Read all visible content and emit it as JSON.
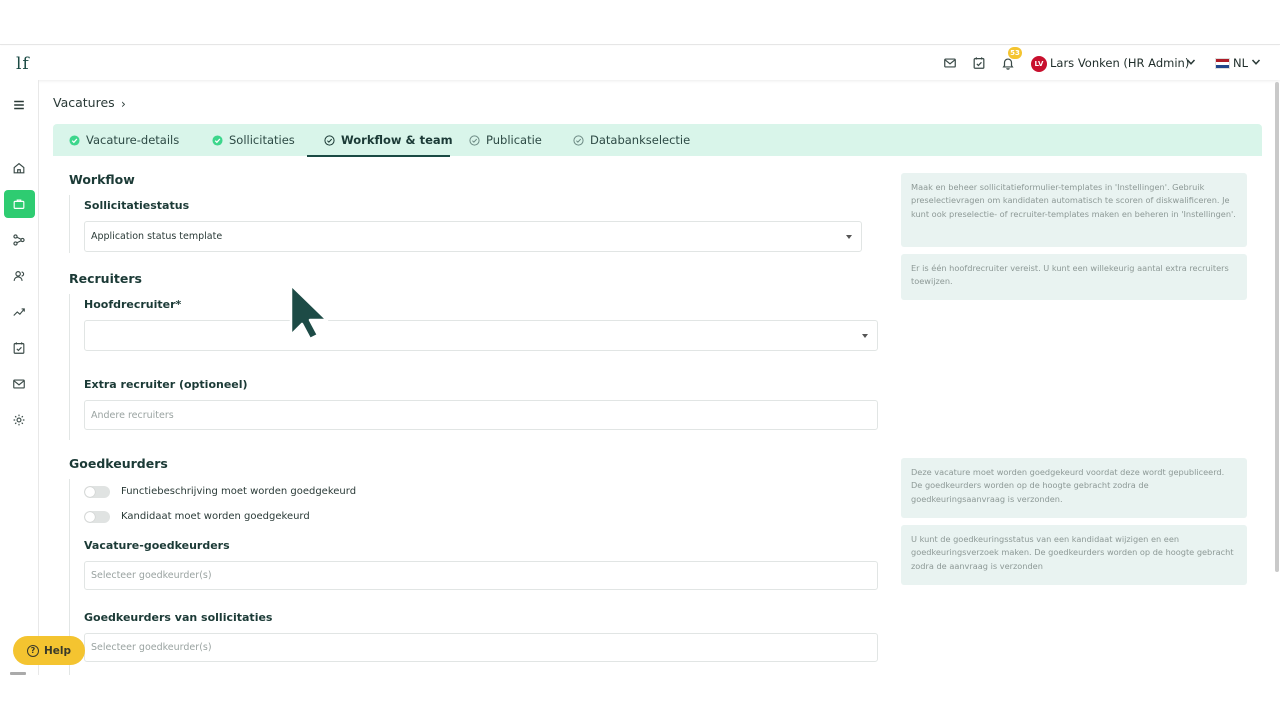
{
  "app": {
    "logo_text": "lf",
    "user_initials": "LV",
    "user_name": "Lars Vonken (HR Admin)",
    "notification_count": "53",
    "language": "NL",
    "accent_color": "#2ecc71",
    "brand_color": "#1b4a44"
  },
  "topbar": {
    "icons": [
      "mail-icon",
      "task-check-icon",
      "bell-icon"
    ]
  },
  "sidebar": {
    "icons": [
      "menu-icon",
      "home-icon",
      "briefcase-icon",
      "workflow-icon",
      "users-icon",
      "chart-icon",
      "calendar-check-icon",
      "mail-icon",
      "gear-icon"
    ]
  },
  "breadcrumb": {
    "label": "Vacatures",
    "separator": "›"
  },
  "tabs": [
    {
      "label": "Vacature-details",
      "state": "complete"
    },
    {
      "label": "Sollicitaties",
      "state": "complete"
    },
    {
      "label": "Workflow & team",
      "state": "active"
    },
    {
      "label": "Publicatie",
      "state": "pending"
    },
    {
      "label": "Databankselectie",
      "state": "pending"
    }
  ],
  "workflow": {
    "title": "Workflow",
    "status_label": "Sollicitatiestatus",
    "status_value": "Application status template",
    "info": "Maak en beheer sollicitatieformulier-templates in 'Instellingen'. Gebruik preselectievragen om kandidaten automatisch te scoren of diskwalificeren. Je kunt ook preselectie- of recruiter-templates maken en beheren in 'Instellingen'."
  },
  "recruiters": {
    "title": "Recruiters",
    "main_label": "Hoofdrecruiter*",
    "main_value": "",
    "extra_label": "Extra recruiter (optioneel)",
    "extra_placeholder": "Andere recruiters",
    "info": "Er is één hoofdrecruiter vereist. U kunt een willekeurig aantal extra recruiters toewijzen."
  },
  "approvers": {
    "title": "Goedkeurders",
    "toggle1_label": "Functiebeschrijving moet worden goedgekeurd",
    "toggle1_on": false,
    "toggle2_label": "Kandidaat moet worden goedgekeurd",
    "toggle2_on": false,
    "vacancy_label": "Vacature-goedkeurders",
    "vacancy_placeholder": "Selecteer goedkeurder(s)",
    "application_label": "Goedkeurders van sollicitaties",
    "application_placeholder": "Selecteer goedkeurder(s)",
    "info1": "Deze vacature moet worden goedgekeurd voordat deze wordt gepubliceerd. De goedkeurders worden op de hoogte gebracht zodra de goedkeuringsaanvraag is verzonden.",
    "info2": "U kunt de goedkeuringsstatus van een kandidaat wijzigen en een goedkeuringsverzoek maken. De goedkeurders worden op de hoogte gebracht zodra de aanvraag is verzonden"
  },
  "help": {
    "label": "Help"
  }
}
